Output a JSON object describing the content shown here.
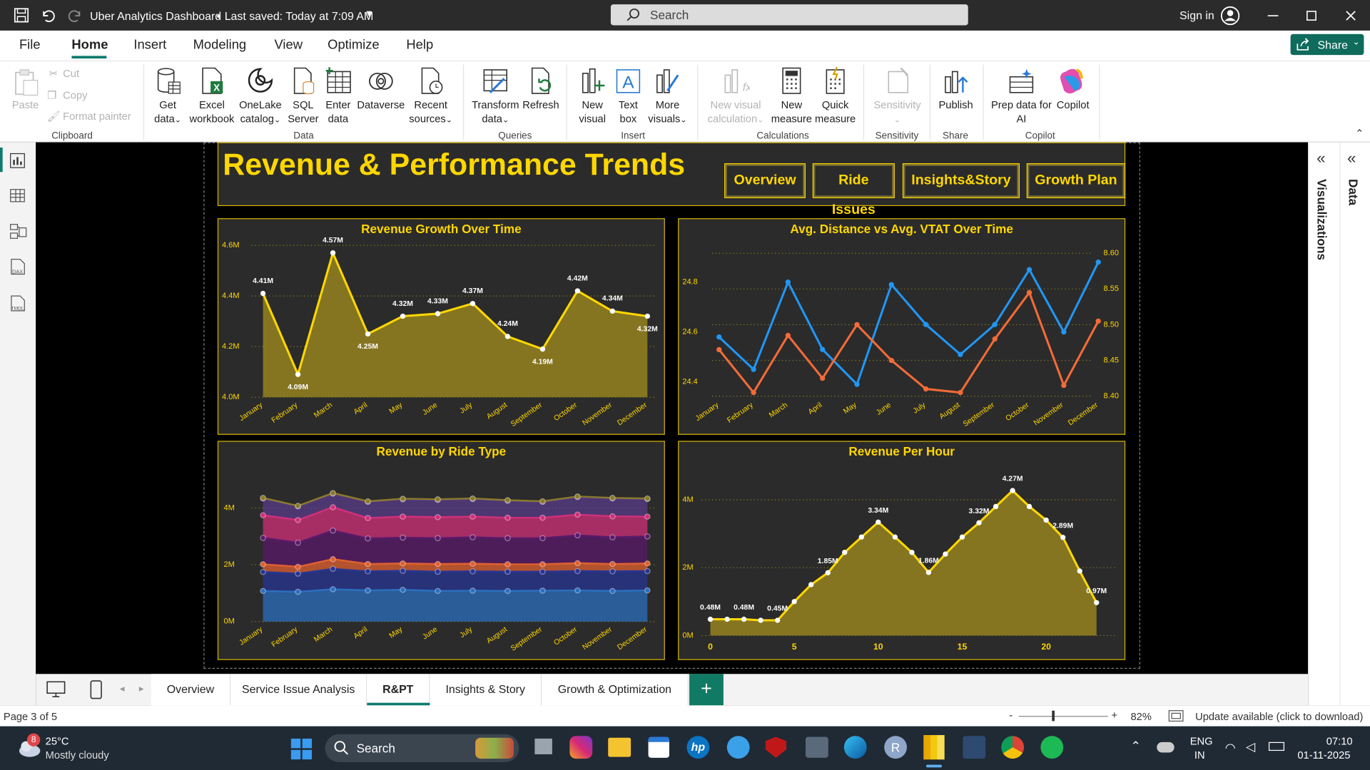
{
  "window": {
    "title": "Uber Analytics Dashboard",
    "saved": "Last saved: Today at 7:09 AM",
    "search": "Search",
    "signin": "Sign in"
  },
  "menu": [
    "File",
    "Home",
    "Insert",
    "Modeling",
    "View",
    "Optimize",
    "Help"
  ],
  "share": "Share",
  "ribbon": {
    "clipboard": {
      "paste": "Paste",
      "cut": "Cut",
      "copy": "Copy",
      "format": "Format painter",
      "label": "Clipboard"
    },
    "data": {
      "get": [
        "Get",
        "data"
      ],
      "excel": [
        "Excel",
        "workbook"
      ],
      "onelake": [
        "OneLake",
        "catalog"
      ],
      "sql": [
        "SQL",
        "Server"
      ],
      "enter": [
        "Enter",
        "data"
      ],
      "dataverse": [
        "Dataverse",
        ""
      ],
      "recent": [
        "Recent",
        "sources"
      ],
      "label": "Data"
    },
    "queries": {
      "transform": [
        "Transform",
        "data"
      ],
      "refresh": [
        "Refresh",
        ""
      ],
      "label": "Queries"
    },
    "insert": {
      "newvisual": [
        "New",
        "visual"
      ],
      "textbox": [
        "Text",
        "box"
      ],
      "more": [
        "More",
        "visuals"
      ],
      "label": "Insert"
    },
    "calc": {
      "newcalc": [
        "New visual",
        "calculation"
      ],
      "newmeasure": [
        "New",
        "measure"
      ],
      "quick": [
        "Quick",
        "measure"
      ],
      "label": "Calculations"
    },
    "sensitivity": {
      "btn": "Sensitivity",
      "label": "Sensitivity"
    },
    "share": {
      "publish": "Publish",
      "label": "Share"
    },
    "copilot": {
      "prep": [
        "Prep data for",
        "AI"
      ],
      "copilot": "Copilot",
      "label": "Copilot"
    }
  },
  "right_panes": {
    "visualizations": "Visualizations",
    "data": "Data"
  },
  "report": {
    "title": "Revenue & Performance Trends",
    "nav": [
      "Overview",
      "Ride Issues",
      "Insights&Story",
      "Growth Plan"
    ]
  },
  "chart_data": [
    {
      "type": "area",
      "title": "Revenue Growth Over Time",
      "categories": [
        "January",
        "February",
        "March",
        "April",
        "May",
        "June",
        "July",
        "August",
        "September",
        "October",
        "November",
        "December"
      ],
      "values": [
        4.41,
        4.09,
        4.57,
        4.25,
        4.32,
        4.33,
        4.37,
        4.24,
        4.19,
        4.42,
        4.34,
        4.32
      ],
      "labels": [
        "4.41M",
        "4.09M",
        "4.57M",
        "4.25M",
        "4.32M",
        "4.33M",
        "4.37M",
        "4.24M",
        "4.19M",
        "4.42M",
        "4.34M",
        "4.32M"
      ],
      "yticks": [
        "4.0M",
        "4.2M",
        "4.4M",
        "4.6M"
      ],
      "ylim": [
        4.0,
        4.6
      ],
      "color": "#ffd700"
    },
    {
      "type": "line",
      "title": "Avg. Distance vs Avg. VTAT Over Time",
      "categories": [
        "January",
        "February",
        "March",
        "April",
        "May",
        "June",
        "July",
        "August",
        "September",
        "October",
        "November",
        "December"
      ],
      "series": [
        {
          "axis": "left",
          "color": "#2196f3",
          "values": [
            24.58,
            24.45,
            24.8,
            24.53,
            24.39,
            24.79,
            24.63,
            24.51,
            24.63,
            24.85,
            24.6,
            24.88
          ]
        },
        {
          "axis": "right",
          "color": "#f26b38",
          "values": [
            8.465,
            8.405,
            8.485,
            8.425,
            8.5,
            8.45,
            8.41,
            8.405,
            8.48,
            8.545,
            8.415,
            8.505
          ]
        }
      ],
      "yticks_left": [
        "24.4",
        "24.6",
        "24.8"
      ],
      "ylim_left": [
        24.3,
        24.93
      ],
      "yticks_right": [
        "8.40",
        "8.45",
        "8.50",
        "8.55",
        "8.60"
      ],
      "ylim_right": [
        8.385,
        8.605
      ]
    },
    {
      "type": "area",
      "title": "Revenue by Ride Type",
      "stacked": true,
      "categories": [
        "January",
        "February",
        "March",
        "April",
        "May",
        "June",
        "July",
        "August",
        "September",
        "October",
        "November",
        "December"
      ],
      "series": [
        {
          "color": "#2c6fbf",
          "values": [
            1.08,
            1.05,
            1.14,
            1.1,
            1.12,
            1.08,
            1.09,
            1.08,
            1.09,
            1.1,
            1.08,
            1.1
          ]
        },
        {
          "color": "#283593",
          "values": [
            0.67,
            0.64,
            0.72,
            0.67,
            0.67,
            0.68,
            0.68,
            0.68,
            0.67,
            0.68,
            0.69,
            0.68
          ]
        },
        {
          "color": "#e06030",
          "values": [
            0.27,
            0.24,
            0.34,
            0.26,
            0.26,
            0.27,
            0.27,
            0.26,
            0.26,
            0.28,
            0.26,
            0.27
          ]
        },
        {
          "color": "#5a1a6a",
          "values": [
            0.93,
            0.85,
            1.01,
            0.9,
            0.91,
            0.91,
            0.93,
            0.92,
            0.92,
            0.98,
            0.94,
            0.95
          ]
        },
        {
          "color": "#d0307a",
          "values": [
            0.8,
            0.8,
            0.82,
            0.72,
            0.74,
            0.74,
            0.73,
            0.72,
            0.72,
            0.73,
            0.74,
            0.7
          ]
        },
        {
          "color": "#5a3c8a",
          "values": [
            0.59,
            0.48,
            0.48,
            0.57,
            0.61,
            0.61,
            0.62,
            0.6,
            0.56,
            0.62,
            0.63,
            0.62
          ]
        },
        {
          "color": "#8a7a2a",
          "values": [
            0.02,
            0.02,
            0.02,
            0.02,
            0.02,
            0.02,
            0.02,
            0.02,
            0.02,
            0.02,
            0.02,
            0.02
          ]
        }
      ],
      "yticks": [
        "0M",
        "2M",
        "4M"
      ],
      "ylim": [
        0,
        5.6
      ]
    },
    {
      "type": "area",
      "title": "Revenue Per Hour",
      "x": [
        0,
        1,
        2,
        3,
        4,
        5,
        6,
        7,
        8,
        9,
        10,
        11,
        12,
        13,
        14,
        15,
        16,
        17,
        18,
        19,
        20,
        21,
        22,
        23
      ],
      "values": [
        0.48,
        0.48,
        0.48,
        0.45,
        0.45,
        1.0,
        1.5,
        1.85,
        2.45,
        2.9,
        3.34,
        2.9,
        2.45,
        1.86,
        2.4,
        2.9,
        3.32,
        3.8,
        4.27,
        3.8,
        3.4,
        2.89,
        1.9,
        0.97
      ],
      "labels": {
        "0": "0.48M",
        "2": "0.48M",
        "4": "0.45M",
        "7": "1.85M",
        "10": "3.34M",
        "13": "1.86M",
        "16": "3.32M",
        "18": "4.27M",
        "21": "2.89M",
        "23": "0.97M"
      },
      "xticks": [
        "0",
        "5",
        "10",
        "15",
        "20"
      ],
      "yticks": [
        "0M",
        "2M",
        "4M"
      ],
      "ylim": [
        0,
        4.5
      ],
      "color": "#ffd700"
    }
  ],
  "tabs": [
    "Overview",
    "Service Issue Analysis",
    "R&PT",
    "Insights & Story",
    "Growth & Optimization"
  ],
  "status": {
    "page": "Page 3 of 5",
    "zoom": "82%",
    "update": "Update available (click to download)"
  },
  "taskbar": {
    "temp": "25°C",
    "weather": "Mostly cloudy",
    "badge": "8",
    "search": "Search",
    "lang1": "ENG",
    "lang2": "IN",
    "time": "07:10",
    "date": "01-11-2025"
  }
}
